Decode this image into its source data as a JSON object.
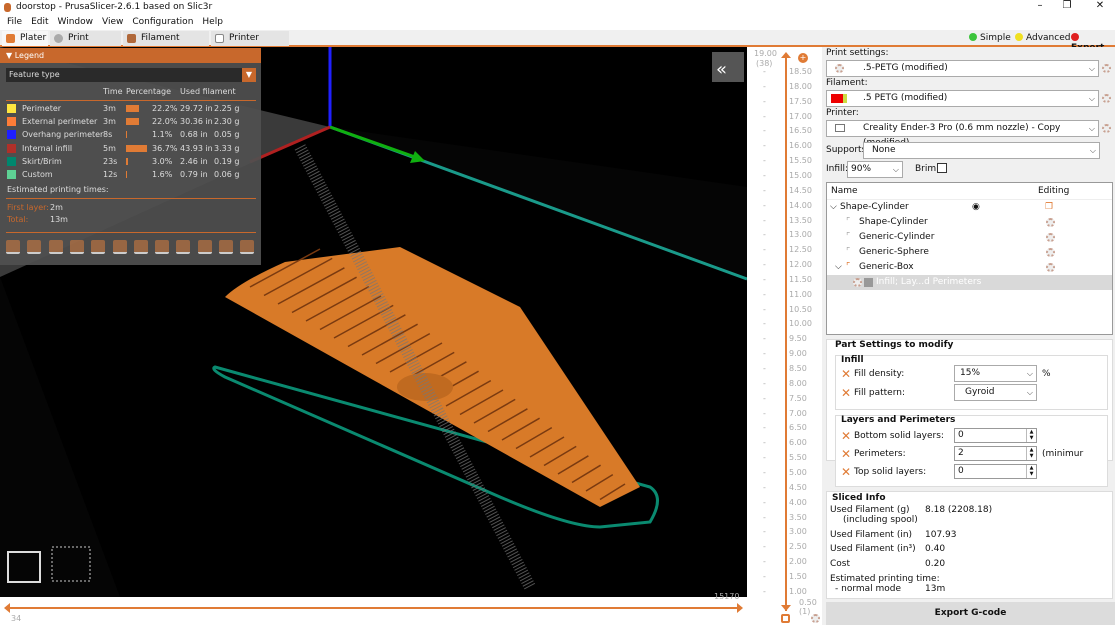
{
  "window": {
    "title": "doorstop - PrusaSlicer-2.6.1 based on Slic3r",
    "minimize": "–",
    "maximize": "❐",
    "close": "✕"
  },
  "menu": [
    "File",
    "Edit",
    "Window",
    "View",
    "Configuration",
    "Help"
  ],
  "tabs": [
    {
      "label": "Plater",
      "color": "#e07b35"
    },
    {
      "label": "Print Settings",
      "color": "#aaaaaa"
    },
    {
      "label": "Filament Settings",
      "color": "#b0683a"
    },
    {
      "label": "Printer Settings",
      "color": "#c0a080"
    }
  ],
  "modes": [
    {
      "label": "Simple",
      "color": "#3cc43c"
    },
    {
      "label": "Advanced",
      "color": "#f0e020"
    },
    {
      "label": "Expert",
      "color": "#e02020"
    }
  ],
  "legend": {
    "title": "Legend",
    "view_type": "Feature type",
    "columns": [
      "Time",
      "Percentage",
      "Used filament"
    ],
    "items": [
      {
        "name": "Perimeter",
        "color": "#ffe640",
        "time": "3m",
        "percent": 22.2,
        "percent_label": "22.2%",
        "length": "29.72 in",
        "weight": "2.25 g"
      },
      {
        "name": "External perimeter",
        "color": "#ff7d38",
        "time": "3m",
        "percent": 22.0,
        "percent_label": "22.0%",
        "length": "30.36 in",
        "weight": "2.30 g"
      },
      {
        "name": "Overhang perimeter",
        "color": "#1f1fff",
        "time": "8s",
        "percent": 1.1,
        "percent_label": "1.1%",
        "length": "0.68 in",
        "weight": "0.05 g"
      },
      {
        "name": "Internal infill",
        "color": "#b03029",
        "time": "5m",
        "percent": 36.7,
        "percent_label": "36.7%",
        "length": "43.93 in",
        "weight": "3.33 g"
      },
      {
        "name": "Skirt/Brim",
        "color": "#00876e",
        "time": "23s",
        "percent": 3.0,
        "percent_label": "3.0%",
        "length": "2.46 in",
        "weight": "0.19 g"
      },
      {
        "name": "Custom",
        "color": "#5ed194",
        "time": "12s",
        "percent": 1.6,
        "percent_label": "1.6%",
        "length": "0.79 in",
        "weight": "0.06 g"
      }
    ],
    "estimated": "Estimated printing times:",
    "first_layer_label": "First layer:",
    "first_layer": "2m",
    "total_label": "Total:",
    "total": "13m"
  },
  "vslider": {
    "top": "19.00",
    "top_layer": "(38)",
    "bottom": "0.50",
    "bottom_layer": "(1)",
    "ticks": [
      "18.50",
      "18.00",
      "17.50",
      "17.00",
      "16.50",
      "16.00",
      "15.50",
      "15.00",
      "14.50",
      "14.00",
      "13.50",
      "13.00",
      "12.50",
      "12.00",
      "11.50",
      "11.00",
      "10.50",
      "10.00",
      "9.50",
      "9.00",
      "8.50",
      "8.00",
      "7.50",
      "7.00",
      "6.50",
      "6.00",
      "5.50",
      "5.00",
      "4.50",
      "4.00",
      "3.50",
      "3.00",
      "2.50",
      "2.00",
      "1.50",
      "1.00"
    ]
  },
  "hslider": {
    "min": "34",
    "max": "15170"
  },
  "right": {
    "print_settings_label": "Print settings:",
    "print_settings": ".5-PETG (modified)",
    "filament_label": "Filament:",
    "filament": ".5 PETG (modified)",
    "printer_label": "Printer:",
    "printer": "Creality Ender-3 Pro (0.6 mm nozzle) - Copy (modified)",
    "supports_label": "Supports:",
    "supports": "None",
    "infill_label": "Infill:",
    "infill": "90%",
    "brim_label": "Brim:",
    "brim": false,
    "tree": {
      "col_name": "Name",
      "col_editing": "Editing",
      "rows": [
        "Shape-Cylinder",
        "Shape-Cylinder",
        "Generic-Cylinder",
        "Generic-Sphere",
        "Generic-Box",
        "Infill; Lay...d Perimeters"
      ]
    },
    "part_settings": {
      "title": "Part Settings to modify",
      "infill_group": "Infill",
      "fill_density_label": "Fill density:",
      "fill_density": "15%",
      "fill_density_unit": "%",
      "fill_pattern_label": "Fill pattern:",
      "fill_pattern": "Gyroid",
      "layers_group": "Layers and Perimeters",
      "bottom_label": "Bottom solid layers:",
      "bottom": "0",
      "perimeters_label": "Perimeters:",
      "perimeters": "2",
      "perimeters_note": "(minimur",
      "top_label": "Top solid layers:",
      "top": "0"
    },
    "sliced": {
      "title": "Sliced Info",
      "rows": [
        {
          "k": "Used Filament (g)",
          "k2": "(including spool)",
          "v": "8.18 (2208.18)"
        },
        {
          "k": "Used Filament (in)",
          "v": "107.93"
        },
        {
          "k": "Used Filament (in³)",
          "v": "0.40"
        },
        {
          "k": "Cost",
          "v": "0.20"
        },
        {
          "k": "Estimated printing time:",
          "k2": "- normal mode",
          "v": "13m"
        }
      ]
    },
    "export": "Export G-code"
  }
}
